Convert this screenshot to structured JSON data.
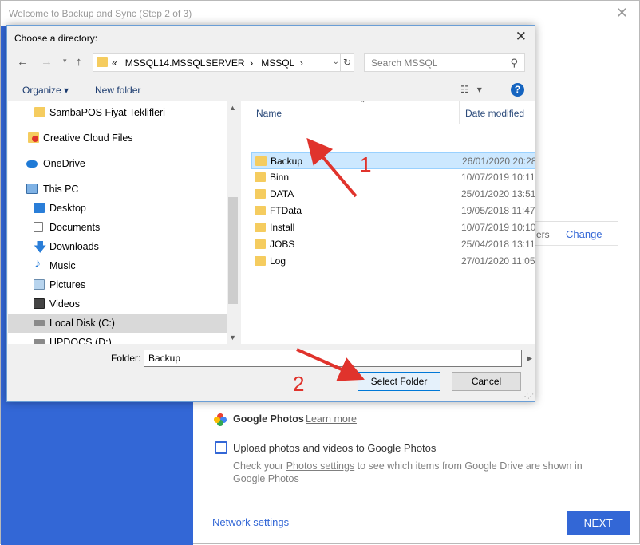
{
  "background_window": {
    "title": "Welcome to Backup and Sync (Step 2 of 3)",
    "close_glyph": "✕",
    "fragment_text": "ers",
    "change_label": "Change",
    "google_photos": {
      "title": "Google Photos",
      "learn_more": "Learn more",
      "upload_label": "Upload photos and videos to Google Photos",
      "desc_prefix": "Check your ",
      "desc_link": "Photos settings",
      "desc_suffix": " to see which items from Google Drive are shown in Google Photos"
    },
    "network_settings": "Network settings",
    "next_button": "NEXT",
    "accent_color": "#3367d6"
  },
  "dialog": {
    "title": "Choose a directory:",
    "address": {
      "chevrons": "«",
      "segments": [
        "MSSQL14.MSSQLSERVER",
        "MSSQL"
      ]
    },
    "search_placeholder": "Search MSSQL",
    "toolbar": {
      "organize": "Organize",
      "new_folder": "New folder"
    },
    "nav_items": [
      {
        "label": "SambaPOS Fiyat Teklifleri",
        "icon": "folder-icon"
      },
      {
        "label": "Creative Cloud Files",
        "icon": "creative-cloud-icon"
      },
      {
        "label": "OneDrive",
        "icon": "cloud-icon"
      },
      {
        "label": "This PC",
        "icon": "computer-icon"
      },
      {
        "label": "Desktop",
        "icon": "desktop-icon"
      },
      {
        "label": "Documents",
        "icon": "documents-icon"
      },
      {
        "label": "Downloads",
        "icon": "download-icon"
      },
      {
        "label": "Music",
        "icon": "music-icon"
      },
      {
        "label": "Pictures",
        "icon": "pictures-icon"
      },
      {
        "label": "Videos",
        "icon": "videos-icon"
      },
      {
        "label": "Local Disk (C:)",
        "icon": "drive-icon",
        "selected": true
      },
      {
        "label": "HPDOCS (D:)",
        "icon": "drive-icon"
      }
    ],
    "columns": {
      "name": "Name",
      "date": "Date modified"
    },
    "files": [
      {
        "name": "Backup",
        "date": "26/01/2020 20:28",
        "selected": true
      },
      {
        "name": "Binn",
        "date": "10/07/2019 10:11"
      },
      {
        "name": "DATA",
        "date": "25/01/2020 13:51"
      },
      {
        "name": "FTData",
        "date": "19/05/2018 11:47"
      },
      {
        "name": "Install",
        "date": "10/07/2019 10:10"
      },
      {
        "name": "JOBS",
        "date": "25/04/2018 13:11"
      },
      {
        "name": "Log",
        "date": "27/01/2020 11:05"
      }
    ],
    "folder_label": "Folder:",
    "folder_value": "Backup",
    "select_button": "Select Folder",
    "cancel_button": "Cancel"
  },
  "annotations": {
    "step1": "1",
    "step2": "2",
    "color": "#e0332c"
  }
}
